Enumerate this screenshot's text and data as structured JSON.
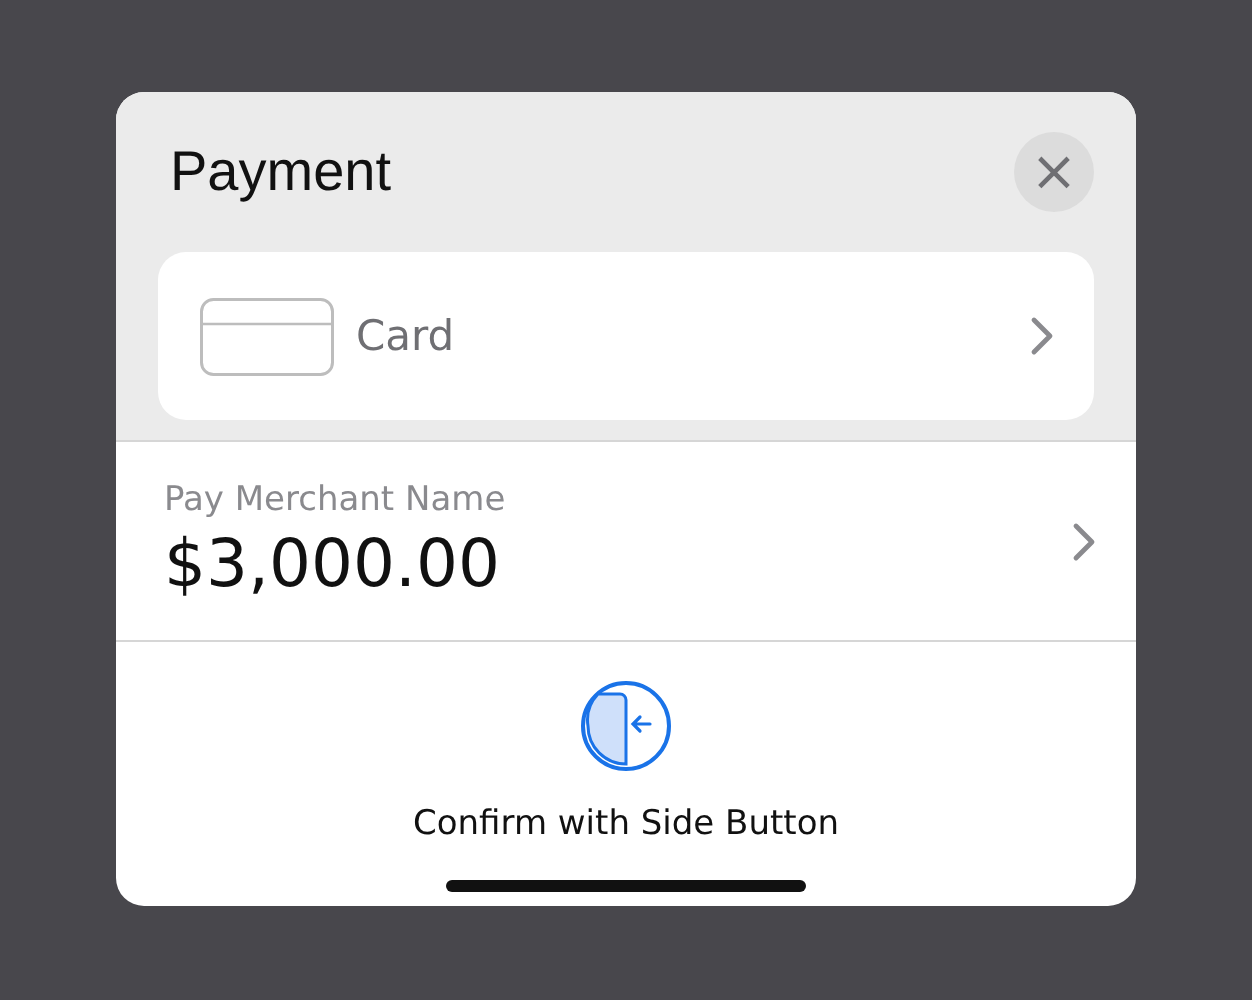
{
  "sheet": {
    "title": "Payment",
    "close": "×"
  },
  "card": {
    "label": "Card"
  },
  "merchant": {
    "label": "Pay Merchant Name",
    "amount": "$3,000.00"
  },
  "confirm": {
    "label": "Confirm with Side Button"
  }
}
